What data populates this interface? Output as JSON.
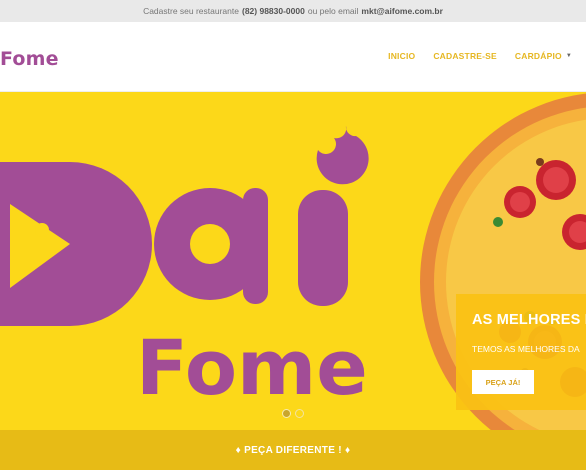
{
  "topbar": {
    "text_before": "Cadastre seu restaurante",
    "phone": "(82) 98830-0000",
    "text_middle": "ou pelo email",
    "email": "mkt@aifome.com.br"
  },
  "header": {
    "logo_text": "Fome",
    "nav": [
      {
        "label": "INICIO"
      },
      {
        "label": "CADASTRE-SE"
      },
      {
        "label": "CARDÁPIO"
      }
    ]
  },
  "hero": {
    "logo_word_top": "ai",
    "logo_word_bottom": "Fome",
    "slide": {
      "title": "AS MELHORES I",
      "subtitle": "TEMOS AS MELHORES DA",
      "button_label": "PEÇA JÁ!"
    },
    "slides_count": 2,
    "active_slide": 1
  },
  "bottom_bar": {
    "label": "♦ PEÇA DIFERENTE ! ♦"
  },
  "colors": {
    "brand_purple": "#a24d96",
    "hero_yellow": "#fcd819",
    "nav_gold": "#e6b722",
    "bar_gold": "#e7bb16"
  }
}
